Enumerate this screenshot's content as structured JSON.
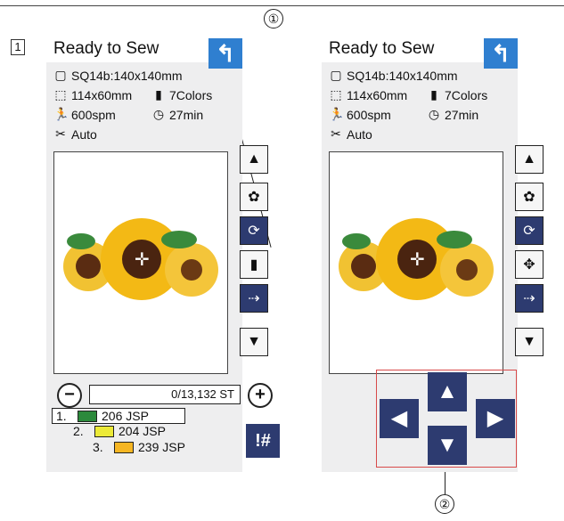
{
  "callouts": {
    "one": "①",
    "two": "②"
  },
  "step_number": "1",
  "panels": {
    "left": {
      "title": "Ready to Sew",
      "hoop": "SQ14b:140x140mm",
      "size": "114x60mm",
      "colors": "7Colors",
      "speed": "600spm",
      "time": "27min",
      "thread_cut": "Auto",
      "stitch_count": "0/13,132 ST",
      "color_list": [
        {
          "number": "1.",
          "code": "206 JSP",
          "color": "#2c8a3c"
        },
        {
          "number": "2.",
          "code": "204 JSP",
          "color": "#ecea38"
        },
        {
          "number": "3.",
          "code": "239 JSP",
          "color": "#f6b623"
        }
      ],
      "jump_label": "!#"
    },
    "right": {
      "title": "Ready to Sew",
      "hoop": "SQ14b:140x140mm",
      "size": "114x60mm",
      "colors": "7Colors",
      "speed": "600spm",
      "time": "27min",
      "thread_cut": "Auto"
    }
  },
  "icons": {
    "return": "↰",
    "hoop": "▢",
    "size": "⬚",
    "spool": "▮",
    "runner": "🏃",
    "clock": "◷",
    "scissors": "✂",
    "up": "▲",
    "down": "▼",
    "left": "◀",
    "right": "▶",
    "minus": "−",
    "plus": "+",
    "crosshair": "✛"
  }
}
